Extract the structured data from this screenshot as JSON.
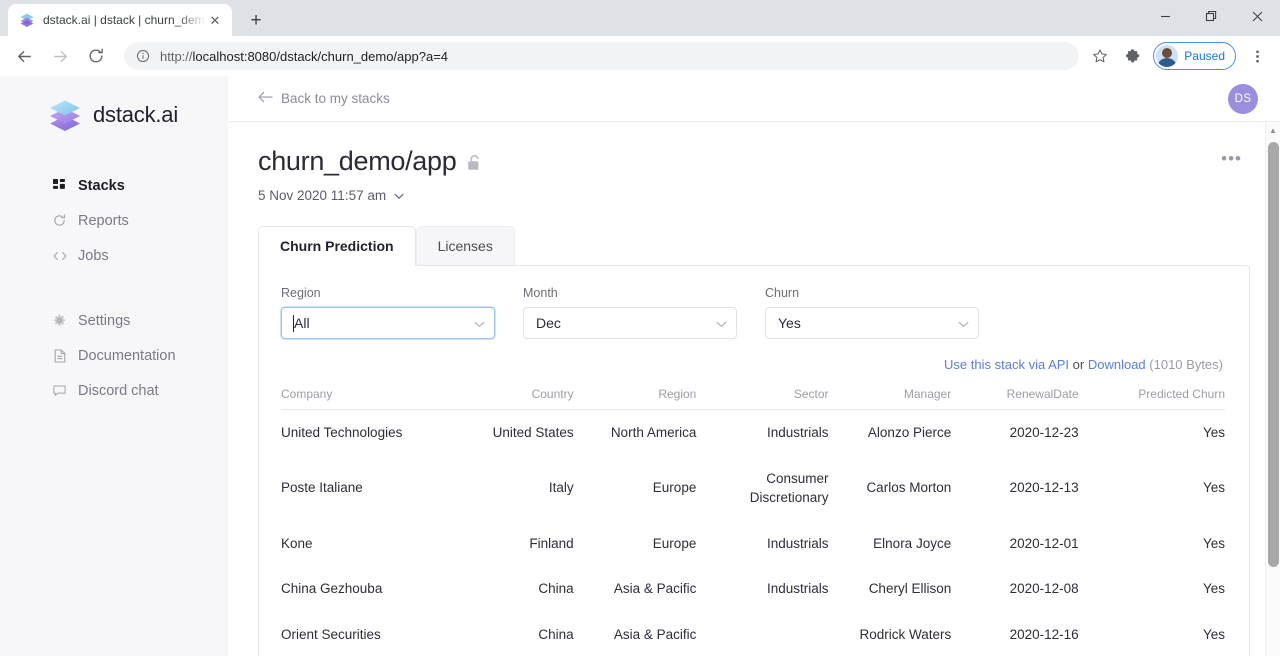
{
  "browser": {
    "tab": {
      "title": "dstack.ai | dstack | churn_demo/a",
      "favicon_icon": "dstack-logo-icon",
      "close_icon": "✕"
    },
    "new_tab_icon": "+",
    "window_controls": {
      "minimize": "minimize-icon",
      "maximize": "maximize-icon",
      "close": "close-icon"
    },
    "nav": {
      "back_icon": "←",
      "forward_icon": "→",
      "reload_icon": "⟳"
    },
    "omnibox": {
      "info_icon": "site-info-icon",
      "url_scheme": "http://",
      "url_rest": "localhost:8080/dstack/churn_demo/app?a=4",
      "url_full": "http://localhost:8080/dstack/churn_demo/app?a=4"
    },
    "bookmark_icon": "star-icon",
    "extensions_icon": "puzzle-icon",
    "profile": {
      "label": "Paused",
      "avatar_icon": "user-avatar-icon",
      "accent": "#1a73e8"
    },
    "menu_icon": "kebab-menu-icon"
  },
  "sidebar": {
    "brand": {
      "name": "dstack.ai",
      "logo_icon": "stacked-layers-logo"
    },
    "items": [
      {
        "label": "Stacks",
        "icon": "grid-icon",
        "active": true
      },
      {
        "label": "Reports",
        "icon": "refresh-icon",
        "active": false
      },
      {
        "label": "Jobs",
        "icon": "code-brackets-icon",
        "active": false
      },
      {
        "label": "Settings",
        "icon": "gear-icon",
        "active": false
      },
      {
        "label": "Documentation",
        "icon": "document-icon",
        "active": false
      },
      {
        "label": "Discord chat",
        "icon": "chat-bubble-icon",
        "active": false
      }
    ]
  },
  "topbar": {
    "back_label": "Back to my stacks",
    "back_icon": "arrow-left-icon",
    "avatar_initials": "DS",
    "avatar_color": "#9b8ede"
  },
  "page": {
    "title": "churn_demo/app",
    "lock_icon": "unlocked-padlock-icon",
    "timestamp": "5 Nov 2020 11:57 am",
    "timestamp_chevron": "⌄",
    "overflow_menu": "•••"
  },
  "tabs": [
    {
      "label": "Churn Prediction",
      "selected": true
    },
    {
      "label": "Licenses",
      "selected": false
    }
  ],
  "filters": [
    {
      "label": "Region",
      "value": "All",
      "focused": true,
      "chevron": "⌄"
    },
    {
      "label": "Month",
      "value": "Dec",
      "focused": false,
      "chevron": "⌄"
    },
    {
      "label": "Churn",
      "value": "Yes",
      "focused": false,
      "chevron": "⌄"
    }
  ],
  "api": {
    "use_api_label": "Use this stack via API",
    "separator": " or ",
    "download_label": "Download",
    "size": " (1010 Bytes)"
  },
  "table": {
    "columns": [
      "Company",
      "Country",
      "Region",
      "Sector",
      "Manager",
      "RenewalDate",
      "Predicted Churn"
    ],
    "rows": [
      {
        "company": "United Technologies",
        "country": "United States",
        "region": "North America",
        "sector": "Industrials",
        "manager": "Alonzo Pierce",
        "renewal_date": "2020-12-23",
        "predicted_churn": "Yes"
      },
      {
        "company": "Poste Italiane",
        "country": "Italy",
        "region": "Europe",
        "sector": "Consumer Discretionary",
        "manager": "Carlos Morton",
        "renewal_date": "2020-12-13",
        "predicted_churn": "Yes"
      },
      {
        "company": "Kone",
        "country": "Finland",
        "region": "Europe",
        "sector": "Industrials",
        "manager": "Elnora Joyce",
        "renewal_date": "2020-12-01",
        "predicted_churn": "Yes"
      },
      {
        "company": "China Gezhouba",
        "country": "China",
        "region": "Asia & Pacific",
        "sector": "Industrials",
        "manager": "Cheryl Ellison",
        "renewal_date": "2020-12-08",
        "predicted_churn": "Yes"
      },
      {
        "company": "Orient Securities",
        "country": "China",
        "region": "Asia & Pacific",
        "sector": "",
        "manager": "Rodrick Waters",
        "renewal_date": "2020-12-16",
        "predicted_churn": "Yes"
      }
    ]
  }
}
